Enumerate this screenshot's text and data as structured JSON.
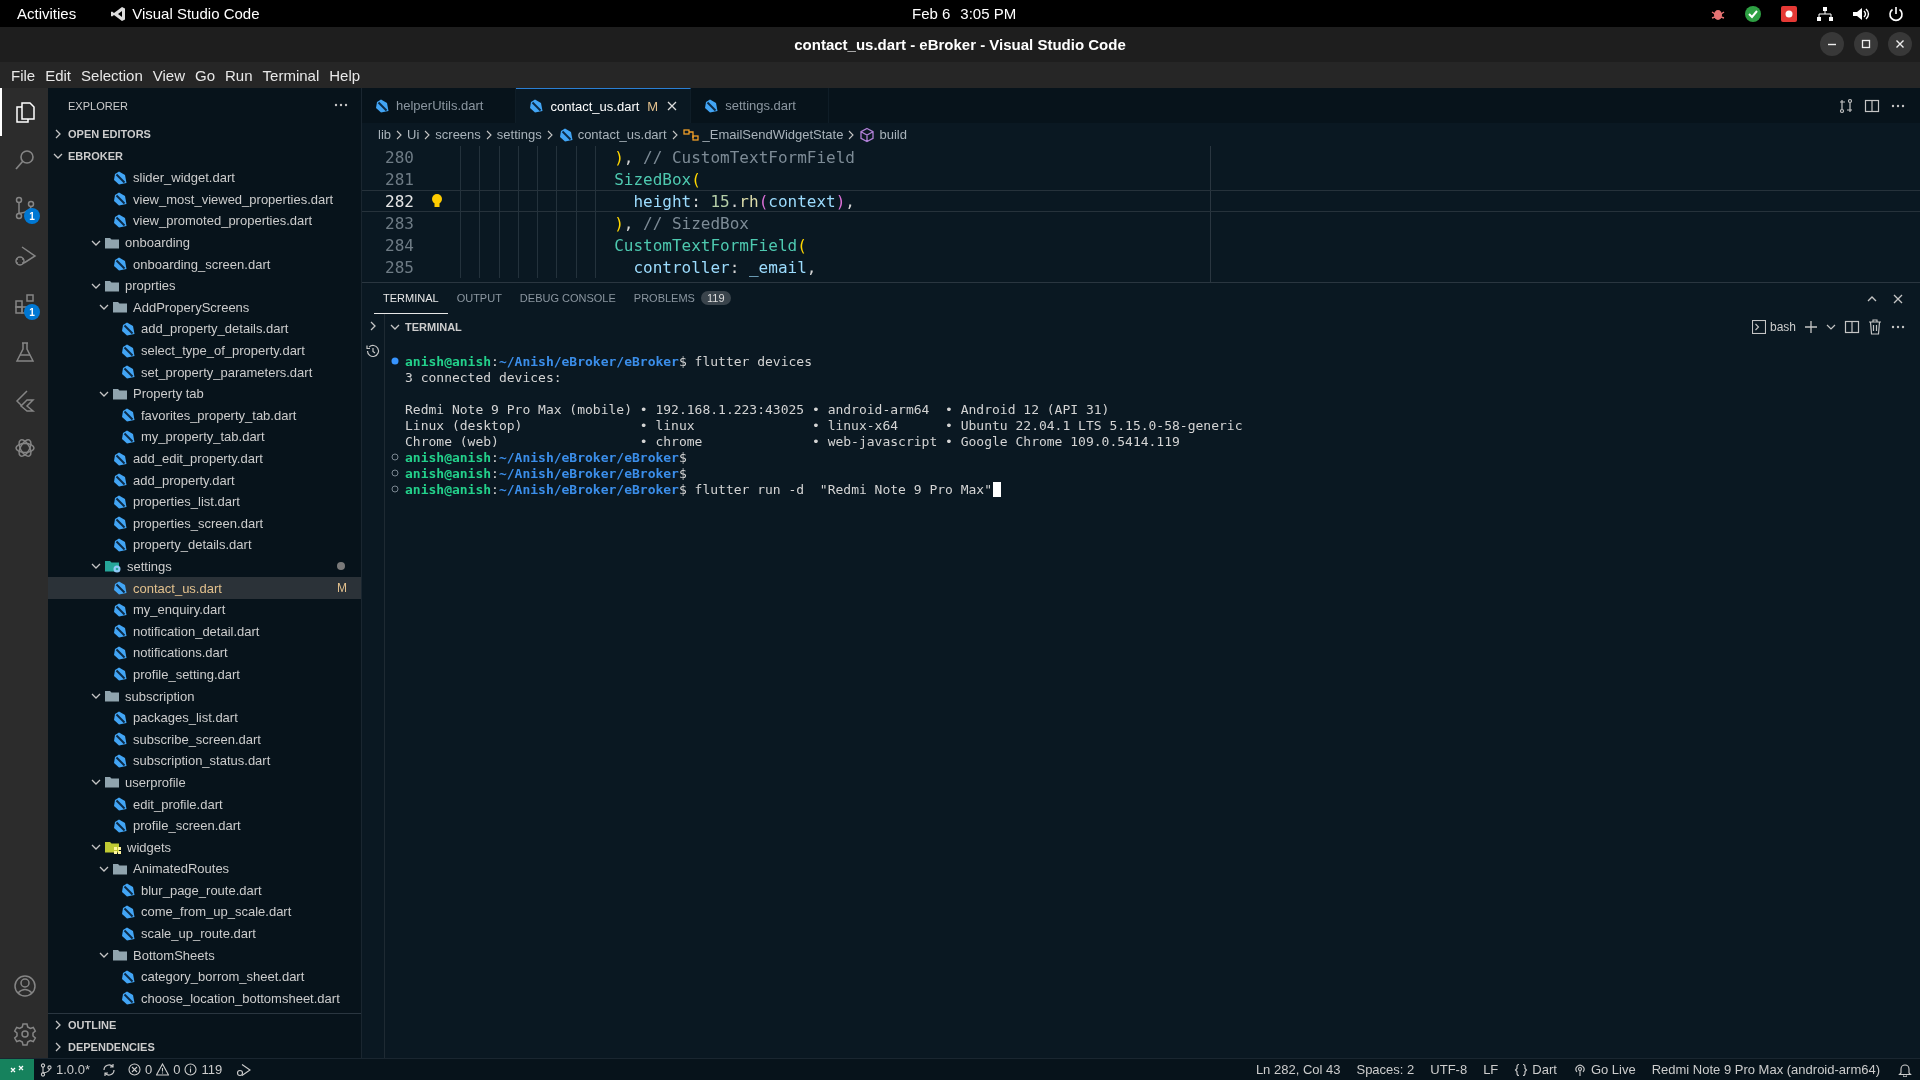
{
  "top_bar": {
    "activities": "Activities",
    "app": "Visual Studio Code",
    "date": "Feb 6",
    "time": "3:05 PM"
  },
  "window": {
    "title": "contact_us.dart - eBroker - Visual Studio Code"
  },
  "menu": [
    "File",
    "Edit",
    "Selection",
    "View",
    "Go",
    "Run",
    "Terminal",
    "Help"
  ],
  "activity_bar": [
    {
      "kind": "explorer",
      "selected": true
    },
    {
      "kind": "search",
      "selected": false
    },
    {
      "kind": "source-control",
      "selected": false,
      "badge": "1"
    },
    {
      "kind": "run",
      "selected": false
    },
    {
      "kind": "extensions",
      "selected": false,
      "badge": "1"
    },
    {
      "kind": "testing",
      "selected": false
    },
    {
      "kind": "flutter",
      "selected": false
    },
    {
      "kind": "knot",
      "selected": false
    },
    {
      "kind": "account",
      "selected": false
    },
    {
      "kind": "settings",
      "selected": false
    }
  ],
  "sidebar": {
    "title": "EXPLORER",
    "sections": [
      {
        "label": "OPEN EDITORS",
        "expanded": false
      },
      {
        "label": "EBROKER",
        "expanded": true
      }
    ],
    "tree": [
      {
        "kind": "scrolled_group",
        "children": [
          {
            "kind": "file",
            "label": "slider_widget.dart",
            "selected": false
          },
          {
            "kind": "file",
            "label": "view_most_viewed_properties.dart",
            "selected": false
          },
          {
            "kind": "file",
            "label": "view_promoted_properties.dart",
            "selected": false
          }
        ]
      },
      {
        "kind": "folder",
        "label": "onboarding",
        "expanded": true,
        "selected": false,
        "modified": false,
        "children": [
          {
            "kind": "file",
            "label": "onboarding_screen.dart",
            "selected": false
          }
        ]
      },
      {
        "kind": "folder",
        "label": "proprties",
        "expanded": true,
        "selected": false,
        "modified": false,
        "children": [
          {
            "kind": "folder",
            "label": "AddProperyScreens",
            "expanded": true,
            "selected": false,
            "modified": false,
            "children": [
              {
                "kind": "file",
                "label": "add_property_details.dart",
                "selected": false
              },
              {
                "kind": "file",
                "label": "select_type_of_property.dart",
                "selected": false
              },
              {
                "kind": "file",
                "label": "set_property_parameters.dart",
                "selected": false
              }
            ]
          },
          {
            "kind": "folder",
            "label": "Property tab",
            "expanded": true,
            "selected": false,
            "modified": false,
            "children": [
              {
                "kind": "file",
                "label": "favorites_property_tab.dart",
                "selected": false
              },
              {
                "kind": "file",
                "label": "my_property_tab.dart",
                "selected": false
              }
            ]
          },
          {
            "kind": "file",
            "label": "add_edit_property.dart",
            "selected": false
          },
          {
            "kind": "file",
            "label": "add_property.dart",
            "selected": false
          },
          {
            "kind": "file",
            "label": "properties_list.dart",
            "selected": false
          },
          {
            "kind": "file",
            "label": "properties_screen.dart",
            "selected": false
          },
          {
            "kind": "file",
            "label": "property_details.dart",
            "selected": false
          }
        ]
      },
      {
        "kind": "settings-folder",
        "label": "settings",
        "expanded": true,
        "selected": false,
        "modified": true,
        "children": [
          {
            "kind": "file",
            "label": "contact_us.dart",
            "selected": true,
            "status": "M"
          },
          {
            "kind": "file",
            "label": "my_enquiry.dart",
            "selected": false
          },
          {
            "kind": "file",
            "label": "notification_detail.dart",
            "selected": false
          },
          {
            "kind": "file",
            "label": "notifications.dart",
            "selected": false
          },
          {
            "kind": "file",
            "label": "profile_setting.dart",
            "selected": false
          }
        ]
      },
      {
        "kind": "folder",
        "label": "subscription",
        "expanded": true,
        "selected": false,
        "modified": false,
        "children": [
          {
            "kind": "file",
            "label": "packages_list.dart",
            "selected": false
          },
          {
            "kind": "file",
            "label": "subscribe_screen.dart",
            "selected": false
          },
          {
            "kind": "file",
            "label": "subscription_status.dart",
            "selected": false
          }
        ]
      },
      {
        "kind": "folder",
        "label": "userprofile",
        "expanded": true,
        "selected": false,
        "modified": false,
        "children": [
          {
            "kind": "file",
            "label": "edit_profile.dart",
            "selected": false
          },
          {
            "kind": "file",
            "label": "profile_screen.dart",
            "selected": false
          }
        ]
      },
      {
        "kind": "widgets-folder",
        "label": "widgets",
        "expanded": true,
        "selected": false,
        "modified": false,
        "children": [
          {
            "kind": "folder",
            "label": "AnimatedRoutes",
            "expanded": true,
            "selected": false,
            "modified": false,
            "children": [
              {
                "kind": "file",
                "label": "blur_page_route.dart",
                "selected": false
              },
              {
                "kind": "file",
                "label": "come_from_up_scale.dart",
                "selected": false
              },
              {
                "kind": "file",
                "label": "scale_up_route.dart",
                "selected": false
              }
            ]
          },
          {
            "kind": "folder",
            "label": "BottomSheets",
            "expanded": true,
            "selected": false,
            "modified": false,
            "children": [
              {
                "kind": "file",
                "label": "category_borrom_sheet.dart",
                "selected": false
              },
              {
                "kind": "file",
                "label": "choose_location_bottomsheet.dart",
                "selected": false
              }
            ]
          }
        ]
      }
    ],
    "bottom_sections": [
      {
        "label": "OUTLINE",
        "expanded": false
      },
      {
        "label": "DEPENDENCIES",
        "expanded": false
      }
    ]
  },
  "tabs": [
    {
      "label": "helperUtils.dart",
      "selected": false
    },
    {
      "label": "contact_us.dart",
      "selected": true,
      "status": "M"
    },
    {
      "label": "settings.dart",
      "selected": false
    }
  ],
  "breadcrumb": [
    {
      "kind": "folder",
      "text": "lib"
    },
    {
      "kind": "folder",
      "text": "Ui"
    },
    {
      "kind": "folder",
      "text": "screens"
    },
    {
      "kind": "folder",
      "text": "settings"
    },
    {
      "kind": "file",
      "text": "contact_us.dart"
    },
    {
      "kind": "class",
      "text": "_EmailSendWidgetState"
    },
    {
      "kind": "method",
      "text": "build"
    }
  ],
  "code": [
    {
      "number": "280",
      "current": false,
      "lightbulb": false,
      "kind": "outer",
      "tokens": [
        {
          "kind": "bracket",
          "text": ")"
        },
        {
          "kind": "punct",
          "text": ", "
        },
        {
          "kind": "comment",
          "text": "// CustomTextFormField"
        }
      ]
    },
    {
      "number": "281",
      "current": false,
      "lightbulb": false,
      "kind": "outer",
      "tokens": [
        {
          "kind": "class",
          "text": "SizedBox"
        },
        {
          "kind": "bracket",
          "text": "("
        }
      ]
    },
    {
      "number": "282",
      "current": true,
      "lightbulb": true,
      "kind": "inner",
      "tokens": [
        {
          "kind": "property",
          "text": "height"
        },
        {
          "kind": "punct",
          "text": ": "
        },
        {
          "kind": "number",
          "text": "15"
        },
        {
          "kind": "punct",
          "text": "."
        },
        {
          "kind": "method",
          "text": "rh"
        },
        {
          "kind": "bracket2",
          "text": "("
        },
        {
          "kind": "property",
          "text": "context"
        },
        {
          "kind": "bracket2",
          "text": ")"
        },
        {
          "kind": "punct",
          "text": ","
        }
      ]
    },
    {
      "number": "283",
      "current": false,
      "lightbulb": false,
      "kind": "outer",
      "tokens": [
        {
          "kind": "bracket",
          "text": ")"
        },
        {
          "kind": "punct",
          "text": ", "
        },
        {
          "kind": "comment",
          "text": "// SizedBox"
        }
      ]
    },
    {
      "number": "284",
      "current": false,
      "lightbulb": false,
      "kind": "outer",
      "tokens": [
        {
          "kind": "class",
          "text": "CustomTextFormField"
        },
        {
          "kind": "bracket",
          "text": "("
        }
      ]
    },
    {
      "number": "285",
      "current": false,
      "lightbulb": false,
      "kind": "inner",
      "tokens": [
        {
          "kind": "property",
          "text": "controller"
        },
        {
          "kind": "punct",
          "text": ": "
        },
        {
          "kind": "property",
          "text": "_email"
        },
        {
          "kind": "punct",
          "text": ","
        }
      ]
    }
  ],
  "panel": {
    "tabs": [
      {
        "label": "TERMINAL",
        "selected": true
      },
      {
        "label": "OUTPUT",
        "selected": false
      },
      {
        "label": "DEBUG CONSOLE",
        "selected": false
      },
      {
        "label": "PROBLEMS",
        "selected": false,
        "badge": "119"
      }
    ],
    "terminal_title": "TERMINAL",
    "shell": "bash",
    "lines": [
      {
        "kind": "prompt",
        "success": true,
        "user": "anish@anish",
        "sep": ":",
        "path": "~/Anish/eBroker/eBroker",
        "symbol": "$",
        "command": "flutter devices"
      },
      {
        "kind": "output",
        "text": "3 connected devices:"
      },
      {
        "kind": "blank"
      },
      {
        "kind": "output",
        "text": "Redmi Note 9 Pro Max (mobile) • 192.168.1.223:43025 • android-arm64  • Android 12 (API 31)"
      },
      {
        "kind": "output",
        "text": "Linux (desktop)               • linux               • linux-x64      • Ubuntu 22.04.1 LTS 5.15.0-58-generic"
      },
      {
        "kind": "output",
        "text": "Chrome (web)                  • chrome              • web-javascript • Google Chrome 109.0.5414.119"
      },
      {
        "kind": "prompt",
        "success": false,
        "user": "anish@anish",
        "sep": ":",
        "path": "~/Anish/eBroker/eBroker",
        "symbol": "$"
      },
      {
        "kind": "prompt",
        "success": false,
        "user": "anish@anish",
        "sep": ":",
        "path": "~/Anish/eBroker/eBroker",
        "symbol": "$"
      },
      {
        "kind": "prompt",
        "success": false,
        "user": "anish@anish",
        "sep": ":",
        "path": "~/Anish/eBroker/eBroker",
        "symbol": "$",
        "command": "flutter run -d  \"Redmi Note 9 Pro Max\"",
        "cursor": true
      }
    ]
  },
  "status_bar": {
    "branch": "1.0.0*",
    "errors": "0",
    "warnings": "0",
    "infos": "119",
    "right": [
      {
        "kind": "text",
        "text": "Ln 282, Col 43"
      },
      {
        "kind": "text",
        "text": "Spaces: 2"
      },
      {
        "kind": "text",
        "text": "UTF-8"
      },
      {
        "kind": "text",
        "text": "LF"
      },
      {
        "kind": "language",
        "text": "Dart"
      },
      {
        "kind": "golive",
        "text": "Go Live"
      },
      {
        "kind": "text",
        "text": "Redmi Note 9 Pro Max (android-arm64)"
      }
    ]
  }
}
